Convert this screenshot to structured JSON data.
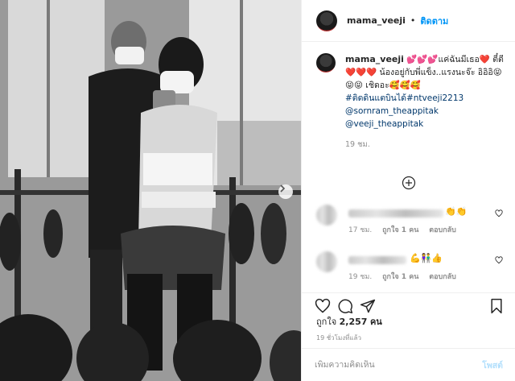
{
  "post": {
    "username": "mama_veeji",
    "follow_label": "ติดตาม",
    "caption_text": "💕💕💕แค่ฉันมีเธอ❤️ ตี๋ตี ❤️❤️❤️ น้องอยู่กับพี่แข็ง..แรงนะจ๊ะ อิอิอิ😝😝😝 เชิดอะ🥰🥰🥰",
    "hashtag": "#ติดดินแตบินได้#ntveeji2213",
    "mention_1": "@sornram_theappitak",
    "mention_2": "@veeji_theappitak",
    "caption_time": "19 ชม.",
    "likes_label": "ถูกใจ",
    "likes_count": "2,257",
    "likes_unit": "คน",
    "time_ago": "19 ชั่วโมงที่แล้ว",
    "comment_placeholder": "เพิ่มความคิดเห็น",
    "post_button": "โพสต์"
  },
  "comments": [
    {
      "emoji": "👏👏",
      "time": "17 ชม.",
      "likes": "ถูกใจ 1 คน",
      "reply": "ตอบกลับ"
    },
    {
      "emoji": "💪👫👍",
      "time": "19 ชม.",
      "likes": "ถูกใจ 1 คน",
      "reply": "ตอบกลับ"
    }
  ],
  "icons": {
    "more_comments": "plus-circle-icon",
    "like": "heart-icon",
    "comment": "comment-icon",
    "share": "share-icon",
    "save": "bookmark-icon",
    "carousel_next": "chevron-right-icon"
  },
  "colors": {
    "link": "#00376b",
    "follow": "#0095f6",
    "muted": "#8e8e8e"
  }
}
